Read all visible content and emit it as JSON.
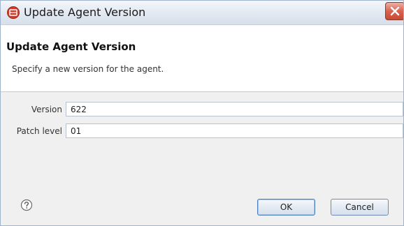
{
  "window": {
    "title": "Update Agent Version"
  },
  "banner": {
    "title": "Update Agent Version",
    "description": "Specify a new version for the agent."
  },
  "form": {
    "version": {
      "label": "Version",
      "value": "622"
    },
    "patch_level": {
      "label": "Patch level",
      "value": "01"
    }
  },
  "buttons": {
    "ok_label": "OK",
    "cancel_label": "Cancel"
  },
  "icons": {
    "app": "app-icon",
    "close": "close-icon",
    "help": "help-icon"
  },
  "colors": {
    "app_icon": "#d83a2a",
    "close_button": "#d9624f"
  }
}
